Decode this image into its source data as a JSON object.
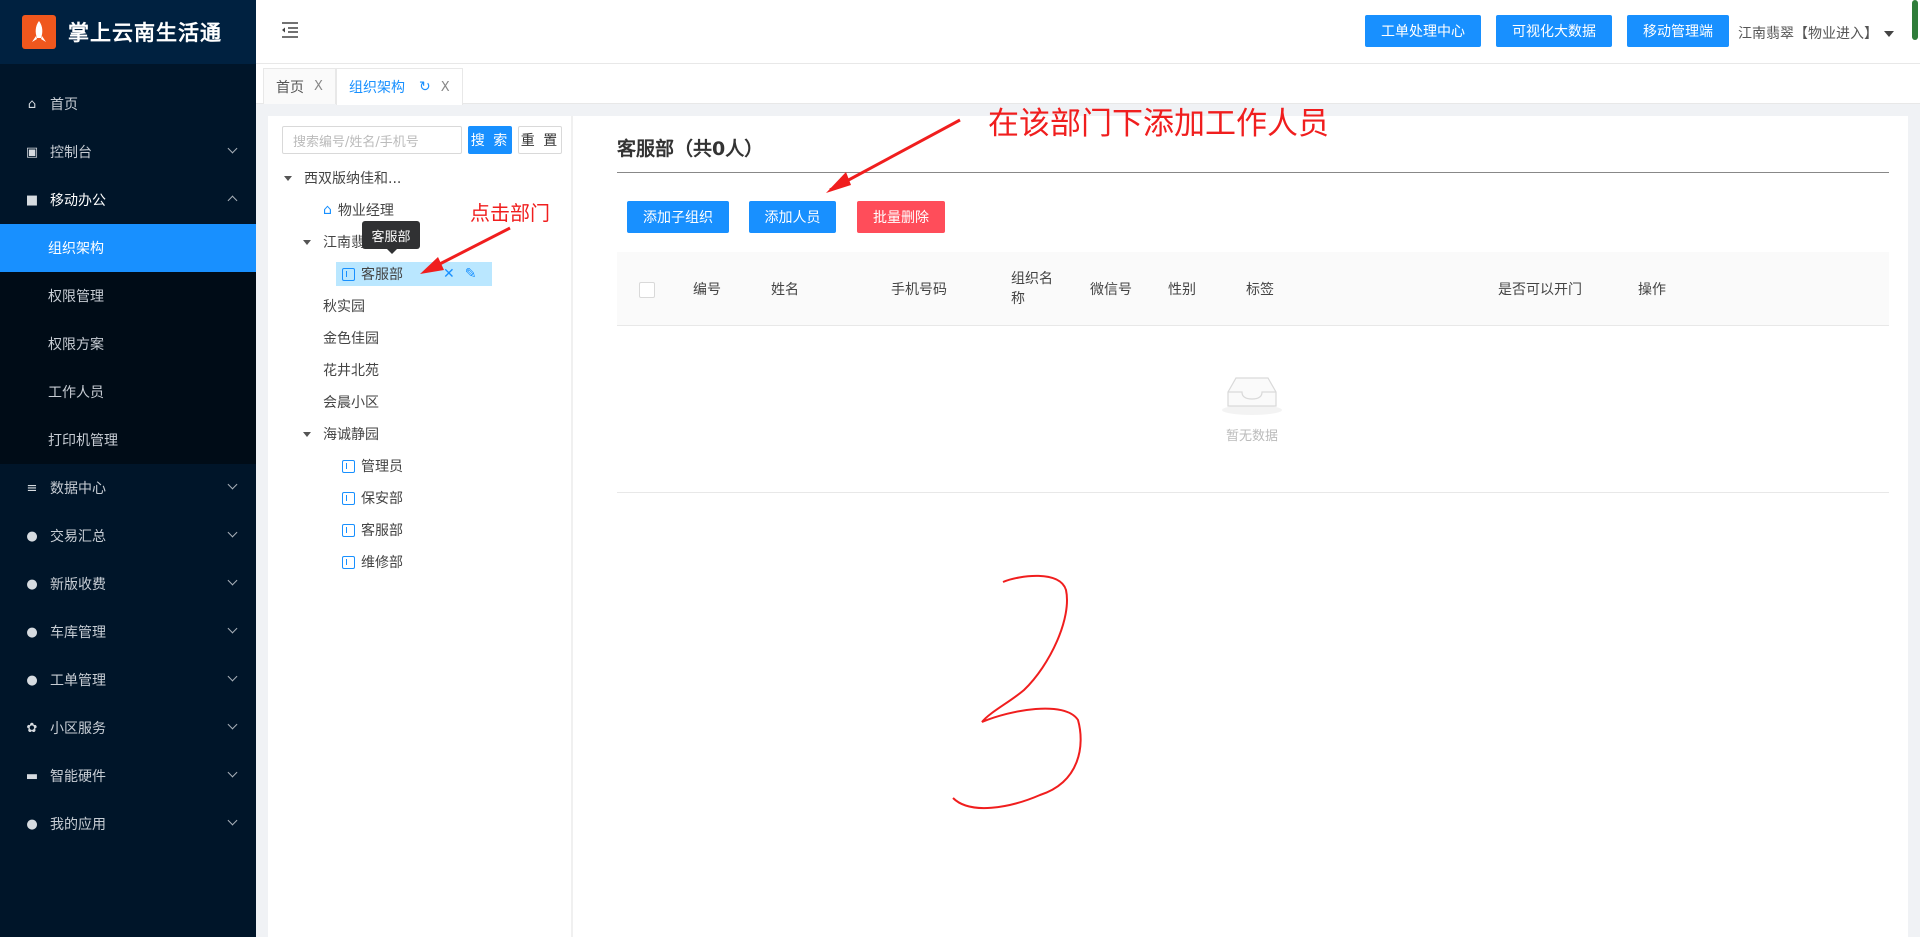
{
  "app": {
    "title": "掌上云南生活通",
    "logo_icon": "rocket-logo-icon"
  },
  "sidebar": {
    "items": [
      {
        "label": "首页",
        "icon": "home-icon"
      },
      {
        "label": "控制台",
        "icon": "monitor-icon"
      },
      {
        "label": "移动办公",
        "icon": "briefcase-icon"
      },
      {
        "label": "数据中心",
        "icon": "database-icon"
      },
      {
        "label": "交易汇总",
        "icon": "money-bag-icon"
      },
      {
        "label": "新版收费",
        "icon": "chat-icon"
      },
      {
        "label": "车库管理",
        "icon": "chat-icon"
      },
      {
        "label": "工单管理",
        "icon": "chat-icon"
      },
      {
        "label": "小区服务",
        "icon": "medal-icon"
      },
      {
        "label": "智能硬件",
        "icon": "hardware-icon"
      },
      {
        "label": "我的应用",
        "icon": "user-icon"
      }
    ],
    "sub_items": [
      {
        "label": "组织架构",
        "active": true
      },
      {
        "label": "权限管理"
      },
      {
        "label": "权限方案"
      },
      {
        "label": "工作人员"
      },
      {
        "label": "打印机管理"
      }
    ]
  },
  "header": {
    "buttons": [
      "工单处理中心",
      "可视化大数据",
      "移动管理端"
    ],
    "user": "江南翡翠【物业进入】"
  },
  "tabs": [
    {
      "label": "首页",
      "close": "X"
    },
    {
      "label": "组织架构",
      "close": "X",
      "active": true
    }
  ],
  "tree": {
    "search_placeholder": "搜索编号/姓名/手机号",
    "search_label": "搜 索",
    "reset_label": "重 置",
    "root": "西双版纳佳和...",
    "nodes": {
      "manager": "物业经理",
      "jiangnan": "江南翡翠",
      "kefu_selected": "客服部",
      "qiushi": "秋实园",
      "jinse": "金色佳园",
      "huajing": "花井北苑",
      "huichen": "会晨小区",
      "haicheng": "海诚静园",
      "admin": "管理员",
      "baoan": "保安部",
      "kefu2": "客服部",
      "weixiu": "维修部"
    },
    "tooltip": "客服部"
  },
  "main": {
    "dept_title": "客服部（共0人）",
    "buttons": {
      "add_org": "添加子组织",
      "add_person": "添加人员",
      "batch_delete": "批量删除"
    },
    "colors": {
      "primary": "#1890ff",
      "danger": "#ff4d5a"
    },
    "columns": [
      "编号",
      "姓名",
      "手机号码",
      "组织名\n称",
      "微信号",
      "性别",
      "标签",
      "是否可以开门",
      "操作"
    ],
    "empty_text": "暂无数据"
  },
  "annotations": {
    "add_here": "在该部门下添加工作人员",
    "click_dept": "点击部门"
  }
}
